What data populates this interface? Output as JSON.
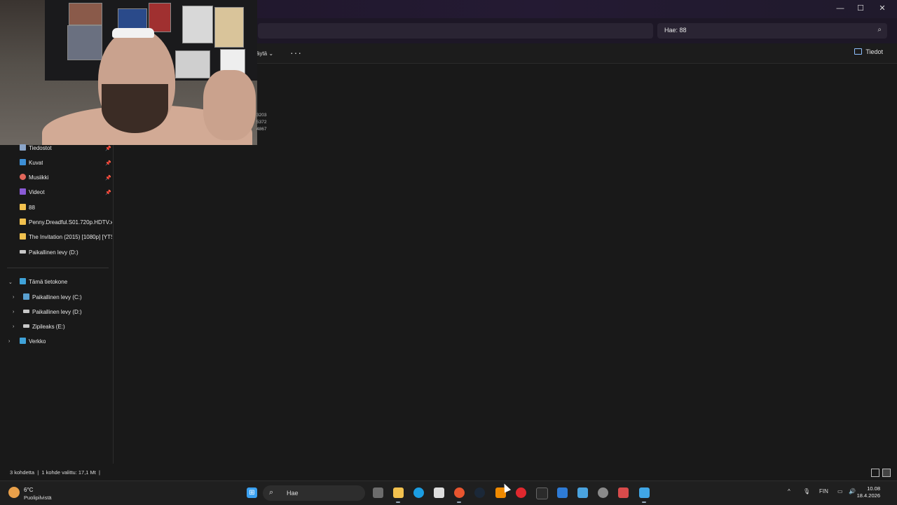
{
  "window": {
    "minimize_glyph": "—",
    "maximize_glyph": "☐",
    "close_glyph": "✕"
  },
  "search": {
    "value": "Hae: 88"
  },
  "commandbar": {
    "view_label_partial": "äytä",
    "more_label": "···",
    "details_label": "Tiedot"
  },
  "overlay_numbers": [
    "3203",
    "5372",
    "4867"
  ],
  "sidebar": {
    "quick_access": [
      {
        "label": "Tiedostot",
        "icon": "document-icon",
        "color": "#8aa4c8",
        "pinned": true
      },
      {
        "label": "Kuvat",
        "icon": "pictures-icon",
        "color": "#3d8fd6",
        "pinned": true
      },
      {
        "label": "Musiikki",
        "icon": "music-icon",
        "color": "#e2665a",
        "pinned": true
      },
      {
        "label": "Videot",
        "icon": "video-icon",
        "color": "#8a5ad6",
        "pinned": true
      },
      {
        "label": "88",
        "icon": "folder-icon",
        "color": "#f2c14e",
        "pinned": false
      },
      {
        "label": "Penny.Dreadful.S01.720p.HDTV.x2",
        "icon": "folder-icon",
        "color": "#f2c14e",
        "pinned": false
      },
      {
        "label": "The Invitation (2015) [1080p] [YTS",
        "icon": "folder-icon",
        "color": "#f2c14e",
        "pinned": false
      },
      {
        "label": "Paikallinen levy (D:)",
        "icon": "drive-icon",
        "color": "#c8c8c8",
        "pinned": false
      }
    ],
    "this_pc": {
      "label": "Tämä tietokone",
      "children": [
        {
          "label": "Paikallinen levy (C:)",
          "icon": "system-drive-icon"
        },
        {
          "label": "Paikallinen levy (D:)",
          "icon": "drive-icon"
        },
        {
          "label": "Zipileaks (E:)",
          "icon": "drive-icon"
        }
      ]
    },
    "network": {
      "label": "Verkko"
    }
  },
  "status": {
    "items_count": "3 kohdetta",
    "selection": "1 kohde valittu: 17,1 Mt"
  },
  "taskbar": {
    "weather_temp": "6°C",
    "weather_desc": "Puolipilvistä",
    "search_label": "Hae",
    "language": "FIN",
    "time": "10.08",
    "date": "18.4.2026",
    "apps": [
      {
        "name": "start-icon",
        "color": "#3aa0f0"
      },
      {
        "name": "task-view-icon",
        "color": "#6c6c6c"
      },
      {
        "name": "file-explorer-icon",
        "color": "#f2c14e"
      },
      {
        "name": "edge-icon",
        "color": "#1b9de2"
      },
      {
        "name": "store-icon",
        "color": "#dddddd"
      },
      {
        "name": "firefox-icon",
        "color": "#e8552f"
      },
      {
        "name": "steam-icon",
        "color": "#1b2838"
      },
      {
        "name": "vlc-icon",
        "color": "#f08a00"
      },
      {
        "name": "opera-icon",
        "color": "#e0282e"
      },
      {
        "name": "terminal-icon",
        "color": "#2b2b2b"
      },
      {
        "name": "snipping-icon",
        "color": "#2e7bd6"
      },
      {
        "name": "remote-desktop-icon",
        "color": "#4aa3df"
      },
      {
        "name": "settings-icon",
        "color": "#8a8a8a"
      },
      {
        "name": "app-icon",
        "color": "#d84b4b"
      },
      {
        "name": "notepad-icon",
        "color": "#40a6e6"
      }
    ]
  }
}
